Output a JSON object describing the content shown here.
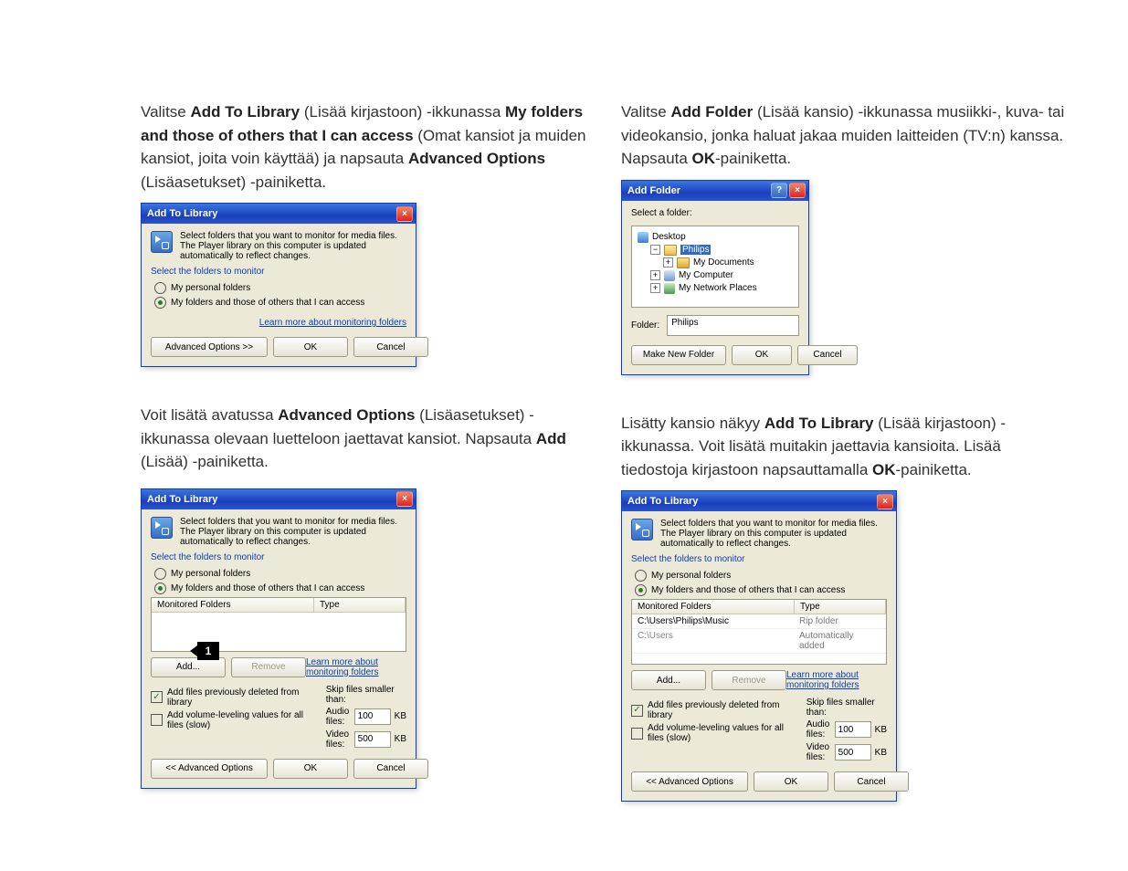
{
  "col1": {
    "p1_a": "Valitse ",
    "p1_bold1": "Add To Library",
    "p1_b": " (Lisää kirjastoon) -ikkunassa ",
    "p1_bold2": "My folders and those of others that I can access",
    "p1_c": " (Omat kansiot ja muiden kansiot, joita voin käyttää) ja napsauta ",
    "p1_bold3": "Advanced Options",
    "p1_d": " (Lisäasetukset) -painiketta.",
    "p2_a": "Voit lisätä avatussa ",
    "p2_bold1": "Advanced Options",
    "p2_b": " (Lisäasetukset) -ikkunassa olevaan luetteloon jaettavat kansiot. Napsauta ",
    "p2_bold2": "Add",
    "p2_c": " (Lisää) -painiketta.",
    "callout1": "1"
  },
  "col2": {
    "p1_a": "Valitse ",
    "p1_bold1": "Add Folder",
    "p1_b": " (Lisää kansio) -ikkunassa musiikki-, kuva- tai videokansio, jonka haluat jakaa muiden laitteiden (TV:n) kanssa. Napsauta ",
    "p1_bold2": "OK",
    "p1_c": "-painiketta.",
    "p2_a": "Lisätty kansio näkyy ",
    "p2_bold1": "Add To Library",
    "p2_b": " (Lisää kirjastoon) -ikkunassa. Voit lisätä muitakin jaettavia kansioita. Lisää tiedostoja kirjastoon napsauttamalla ",
    "p2_bold2": "OK",
    "p2_c": "-painiketta."
  },
  "dlg_atl": {
    "title": "Add To Library",
    "info": "Select folders that you want to monitor for media files. The Player library on this computer is updated automatically to reflect changes.",
    "section": "Select the folders to monitor",
    "radio1": "My personal folders",
    "radio2": "My folders and those of others that I can access",
    "learn": "Learn more about monitoring folders",
    "advopen": "Advanced Options >>",
    "advclose": "<< Advanced Options",
    "ok": "OK",
    "cancel": "Cancel",
    "lv_h1": "Monitored Folders",
    "lv_h2": "Type",
    "add": "Add...",
    "remove": "Remove",
    "chk1": "Add files previously deleted from library",
    "chk2": "Add volume-leveling values for all files (slow)",
    "skip_h": "Skip files smaller than:",
    "skip_a": "Audio files:",
    "skip_v": "Video files:",
    "skip_av": "100",
    "skip_vv": "500",
    "kb": "KB",
    "row1_c1": "C:\\Users\\Philips\\Music",
    "row1_c2": "Rip folder",
    "row2_c1": "C:\\Users",
    "row2_c2": "Automatically added"
  },
  "dlg_af": {
    "title": "Add Folder",
    "select": "Select a folder:",
    "desktop": "Desktop",
    "philips": "Philips",
    "mydocs": "My Documents",
    "mycomp": "My Computer",
    "mynet": "My Network Places",
    "folder_lbl": "Folder:",
    "folder_val": "Philips",
    "newf": "Make New Folder",
    "ok": "OK",
    "cancel": "Cancel"
  }
}
